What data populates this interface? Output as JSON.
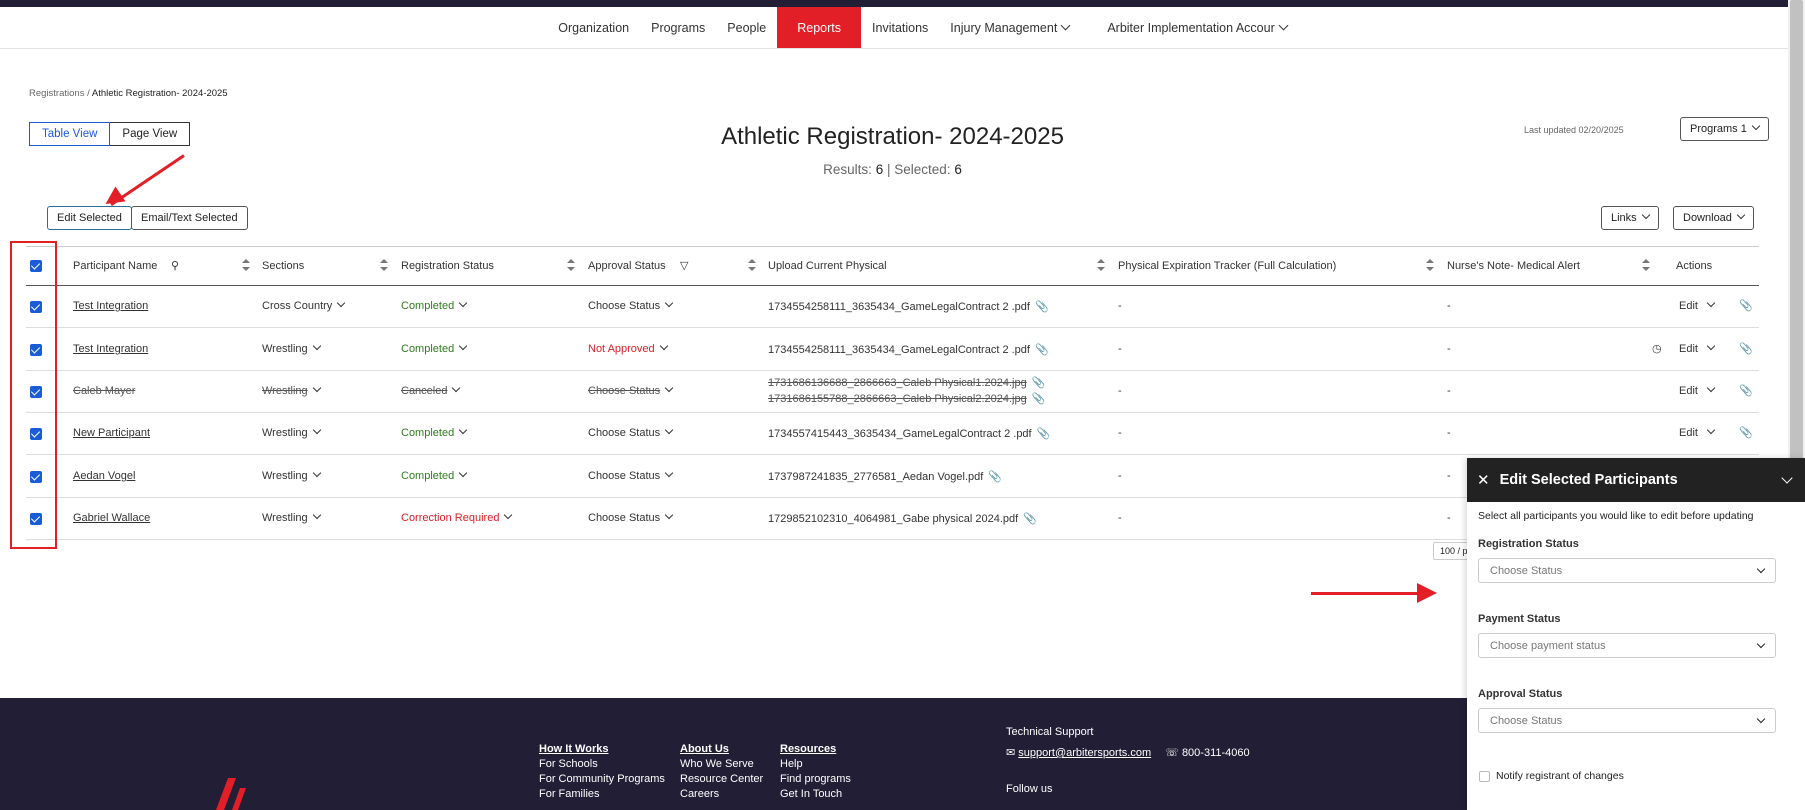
{
  "nav": {
    "items": [
      "Organization",
      "Programs",
      "People",
      "Reports",
      "Invitations",
      "Injury Management",
      "Arbiter Implementation Accour"
    ],
    "active": "Reports"
  },
  "breadcrumb": {
    "parent": "Registrations",
    "sep": "/",
    "current": "Athletic Registration- 2024-2025"
  },
  "views": {
    "table": "Table View",
    "page": "Page View"
  },
  "title": "Athletic Registration- 2024-2025",
  "results": {
    "label": "Results:",
    "count": "6",
    "sep": "|",
    "selected_label": "Selected:",
    "selected": "6"
  },
  "last_updated": "Last updated 02/20/2025",
  "programs_button": "Programs 1",
  "toolbar": {
    "edit_selected": "Edit Selected",
    "email_text_selected": "Email/Text Selected",
    "links": "Links",
    "download": "Download"
  },
  "columns": [
    "Participant Name",
    "Sections",
    "Registration Status",
    "Approval Status",
    "Upload Current Physical",
    "Physical Expiration Tracker (Full Calculation)",
    "Nurse's Note- Medical Alert",
    "Actions"
  ],
  "rows": [
    {
      "name": "Test Integration",
      "section": "Cross Country",
      "reg_status": "Completed",
      "reg_color": "green",
      "approval": "Choose Status",
      "approval_color": "",
      "file1": "1734554258111_3635434_GameLegalContract 2 .pdf",
      "file2": "",
      "expiry": "-",
      "nurse": "-",
      "action": "Edit",
      "history": false,
      "strike": false
    },
    {
      "name": "Test Integration",
      "section": "Wrestling",
      "reg_status": "Completed",
      "reg_color": "green",
      "approval": "Not Approved",
      "approval_color": "red",
      "file1": "1734554258111_3635434_GameLegalContract 2 .pdf",
      "file2": "",
      "expiry": "-",
      "nurse": "-",
      "action": "Edit",
      "history": true,
      "strike": false
    },
    {
      "name": "Caleb Mayer",
      "section": "Wrestling",
      "reg_status": "Canceled",
      "reg_color": "red",
      "approval": "Choose Status",
      "approval_color": "",
      "file1": "1731686136688_2866663_Caleb Physical1.2024.jpg",
      "file2": "1731686155788_2866663_Caleb Physical2.2024.jpg",
      "expiry": "-",
      "nurse": "-",
      "action": "Edit",
      "history": false,
      "strike": true
    },
    {
      "name": "New Participant",
      "section": "Wrestling",
      "reg_status": "Completed",
      "reg_color": "green",
      "approval": "Choose Status",
      "approval_color": "",
      "file1": "1734557415443_3635434_GameLegalContract 2 .pdf",
      "file2": "",
      "expiry": "-",
      "nurse": "-",
      "action": "Edit",
      "history": false,
      "strike": false
    },
    {
      "name": "Aedan Vogel",
      "section": "Wrestling",
      "reg_status": "Completed",
      "reg_color": "green",
      "approval": "Choose Status",
      "approval_color": "",
      "file1": "1737987241835_2776581_Aedan Vogel.pdf",
      "file2": "",
      "expiry": "-",
      "nurse": "-",
      "action": "",
      "history": false,
      "strike": false
    },
    {
      "name": "Gabriel Wallace",
      "section": "Wrestling",
      "reg_status": "Correction Required",
      "reg_color": "red",
      "approval": "Choose Status",
      "approval_color": "",
      "file1": "1729852102310_4064981_Gabe physical 2024.pdf",
      "file2": "",
      "expiry": "-",
      "nurse": "-",
      "action": "",
      "history": false,
      "strike": false
    }
  ],
  "pager": "100 / p",
  "panel": {
    "title": "Edit Selected Participants",
    "note": "Select all participants you would like to edit before updating",
    "registration_label": "Registration Status",
    "registration_placeholder": "Choose Status",
    "payment_label": "Payment Status",
    "payment_placeholder": "Choose payment status",
    "approval_label": "Approval Status",
    "approval_placeholder": "Choose Status",
    "notify_label": "Notify registrant of changes"
  },
  "footer": {
    "how": {
      "heading": "How It Works",
      "items": [
        "For Schools",
        "For Community Programs",
        "For Families"
      ]
    },
    "about": {
      "heading": "About Us",
      "items": [
        "Who We Serve",
        "Resource Center",
        "Careers"
      ]
    },
    "resources": {
      "heading": "Resources",
      "items": [
        "Help",
        "Find programs",
        "Get In Touch"
      ]
    },
    "tech_support": "Technical Support",
    "email": "support@arbitersports.com",
    "phone": "800-311-4060",
    "follow": "Follow us"
  },
  "colors": {
    "accent": "#e21e26",
    "footer_bg": "#221e35",
    "link_blue": "#1a5bd6"
  }
}
